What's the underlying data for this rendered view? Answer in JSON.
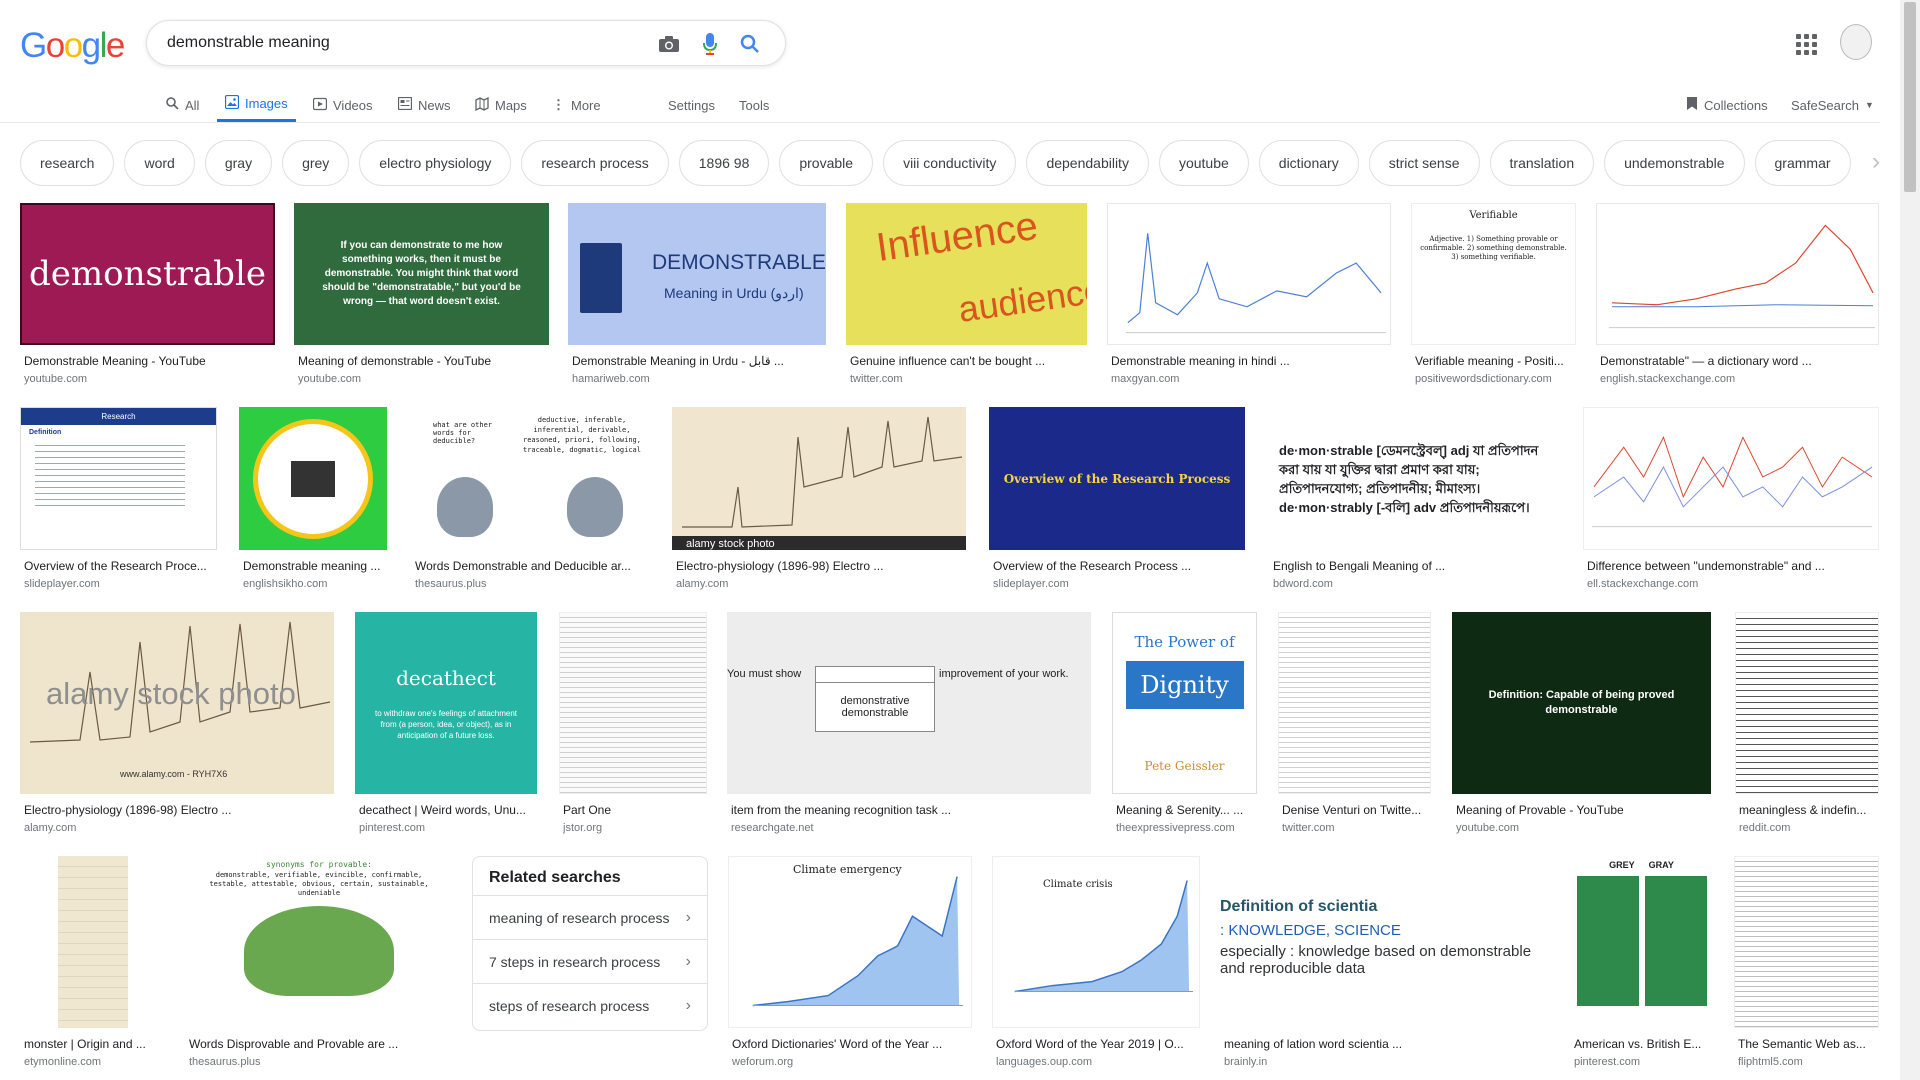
{
  "search": {
    "query": "demonstrable meaning"
  },
  "logo": {
    "text": "Google"
  },
  "nav": {
    "tabs": [
      {
        "label": "All"
      },
      {
        "label": "Images"
      },
      {
        "label": "Videos"
      },
      {
        "label": "News"
      },
      {
        "label": "Maps"
      },
      {
        "label": "More"
      }
    ],
    "settings": "Settings",
    "tools": "Tools",
    "collections": "Collections",
    "safesearch": "SafeSearch"
  },
  "chips": [
    "research",
    "word",
    "gray",
    "grey",
    "electro physiology",
    "research process",
    "1896 98",
    "provable",
    "viii conductivity",
    "dependability",
    "youtube",
    "dictionary",
    "strict sense",
    "translation",
    "undemonstrable",
    "grammar"
  ],
  "results": [
    {
      "title": "Demonstrable Meaning - YouTube",
      "site": "youtube.com",
      "thumb_text": "demonstrable"
    },
    {
      "title": "Meaning of demonstrable - YouTube",
      "site": "youtube.com",
      "thumb_text": "If you can demonstrate to me how something works, then it must be demonstrable. You might think that word should be \"demonstratable,\" but you'd be wrong — that word doesn't exist."
    },
    {
      "title": "Demonstrable Meaning in Urdu - قابل ...",
      "site": "hamariweb.com",
      "thumb_text": "DEMONSTRABLE",
      "thumb_sub": "Meaning in Urdu (اردو)"
    },
    {
      "title": "Genuine influence can't be bought ...",
      "site": "twitter.com",
      "thumb_text": "Influence",
      "thumb_sub": "audience"
    },
    {
      "title": "Demonstrable meaning in hindi ...",
      "site": "maxgyan.com"
    },
    {
      "title": "Verifiable meaning - Positi...",
      "site": "positivewordsdictionary.com",
      "thumb_text": "Verifiable",
      "thumb_sub": "Adjective. 1) Something provable or confirmable. 2) something demonstrable. 3) something verifiable."
    },
    {
      "title": "Demonstratable\" — a dictionary word ...",
      "site": "english.stackexchange.com"
    },
    {
      "title": "Overview of the Research Proce...",
      "site": "slideplayer.com",
      "thumb_text": "Research",
      "thumb_sub": "Definition"
    },
    {
      "title": "Demonstrable meaning ...",
      "site": "englishsikho.com"
    },
    {
      "title": "Words Demonstrable and Deducible ar...",
      "site": "thesaurus.plus",
      "thumb_text": "what are other words for deducible?",
      "thumb_sub": "deductive, inferable, inferential, derivable, reasoned, priori, following, traceable, dogmatic, logical"
    },
    {
      "title": "Electro-physiology (1896-98) Electro ...",
      "site": "alamy.com",
      "thumb_text": "alamy stock photo"
    },
    {
      "title": "Overview of the Research Process ...",
      "site": "slideplayer.com",
      "thumb_text": "Overview of the Research Process"
    },
    {
      "title": "English to Bengali Meaning of ...",
      "site": "bdword.com",
      "thumb_text": "de·mon·strable [ডেমনস্ট্রেবল্] adj যা প্রতিপাদন করা যায় যা যুক্তির দ্বারা প্রমাণ করা যায়; প্রতিপাদনযোগ্য; প্রতিপাদনীয়; মীমাংস্য। de·mon·strably [-বলি] adv প্রতিপাদনীয়রূপে।"
    },
    {
      "title": "Difference between \"undemonstrable\" and ...",
      "site": "ell.stackexchange.com"
    },
    {
      "title": "Electro-physiology (1896-98) Electro ...",
      "site": "alamy.com",
      "thumb_text": "alamy stock photo",
      "thumb_sub": "www.alamy.com - RYH7X6"
    },
    {
      "title": "decathect | Weird words, Unu...",
      "site": "pinterest.com",
      "thumb_text": "decathect",
      "thumb_sub": "to withdraw one's feelings of attachment from (a person, idea, or object), as in anticipation of a future loss."
    },
    {
      "title": "Part One",
      "site": "jstor.org"
    },
    {
      "title": "item from the meaning recognition task ...",
      "site": "researchgate.net",
      "thumb_text": "You must show",
      "thumb_sub": "improvement of your work.",
      "thumb_opt1": "demonstrative",
      "thumb_opt2": "demonstrable"
    },
    {
      "title": "Meaning & Serenity... ...",
      "site": "theexpressivepress.com",
      "thumb_text": "The Power of",
      "thumb_sub": "Dignity",
      "thumb_author": "Pete Geissler"
    },
    {
      "title": "Denise Venturi on Twitte...",
      "site": "twitter.com"
    },
    {
      "title": "Meaning of Provable - YouTube",
      "site": "youtube.com",
      "thumb_text": "Definition: Capable of being proved demonstrable"
    },
    {
      "title": "meaningless & indefin...",
      "site": "reddit.com"
    },
    {
      "title": "monster | Origin and ...",
      "site": "etymonline.com"
    },
    {
      "title": "Words Disprovable and Provable are ...",
      "site": "thesaurus.plus",
      "thumb_text": "synonyms for provable:",
      "thumb_sub": "demonstrable, verifiable, evincible, confirmable, testable, attestable, obvious, certain, sustainable, undeniable"
    },
    {
      "title": "Oxford Dictionaries' Word of the Year ...",
      "site": "weforum.org",
      "thumb_text": "Climate emergency"
    },
    {
      "title": "Oxford Word of the Year 2019 | O...",
      "site": "languages.oup.com",
      "thumb_text": "Climate crisis"
    },
    {
      "title": "meaning of lation word scientia ...",
      "site": "brainly.in",
      "thumb_text": "Definition of scientia",
      "thumb_sub": ": KNOWLEDGE, SCIENCE",
      "thumb_extra": "especially : knowledge based on demonstrable and reproducible data"
    },
    {
      "title": "American vs. British E...",
      "site": "pinterest.com",
      "thumb_text": "GREY",
      "thumb_sub": "GRAY"
    },
    {
      "title": "The Semantic Web as...",
      "site": "fliphtml5.com"
    }
  ],
  "related": {
    "heading": "Related searches",
    "items": [
      "meaning of research process",
      "7 steps in research process",
      "steps of research process"
    ]
  }
}
